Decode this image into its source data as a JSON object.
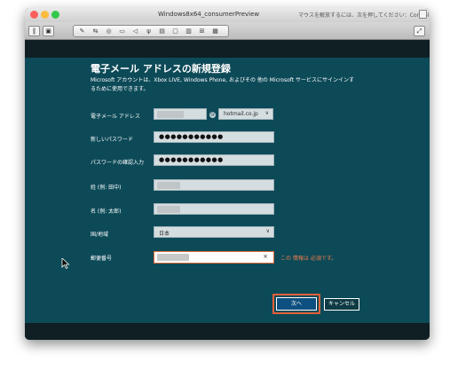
{
  "window": {
    "title": "Windows8x64_consumerPreview",
    "hint": "マウスを解放するには、次を押してください：Control-⌘",
    "traffic_colors": [
      "#fc605c",
      "#fdbc40",
      "#34c84a"
    ]
  },
  "toolbar": {
    "left_buttons": [
      "pause-icon",
      "snapshot-icon"
    ],
    "group_icons": [
      "settings-icon",
      "network-icon",
      "cd-icon",
      "disk-icon",
      "sound-icon",
      "usb-icon",
      "camera-icon",
      "folder-icon",
      "shared-icon",
      "printer-icon",
      "monitor-icon"
    ],
    "right_button": "fullscreen-icon"
  },
  "form": {
    "heading": "電子メール アドレスの新規登録",
    "description": "Microsoft アカウントは、Xbox LIVE, Windows Phone, およびその 他の Microsoft サービスにサインインするために使用できます。",
    "email_label": "電子メール アドレス",
    "email_domain": "hotmail.co.jp",
    "password_label": "新しいパスワード",
    "password_value": "●●●●●●●●●●●",
    "confirm_label": "パスワードの確認入力",
    "confirm_value": "●●●●●●●●●●●",
    "lastname_label": "姓 (例: 田中)",
    "firstname_label": "名 (例: 太郎)",
    "country_label": "国/地域",
    "country_value": "日本",
    "postal_label": "郵便番号",
    "postal_error": "この 情報は 必須です。",
    "next_button": "次へ",
    "cancel_button": "キャンセル"
  },
  "colors": {
    "background": "#0d4a58",
    "band": "#0f1f24",
    "error": "#f07c4c",
    "primary_button": "#0c4f80",
    "highlight": "#e2603a"
  }
}
